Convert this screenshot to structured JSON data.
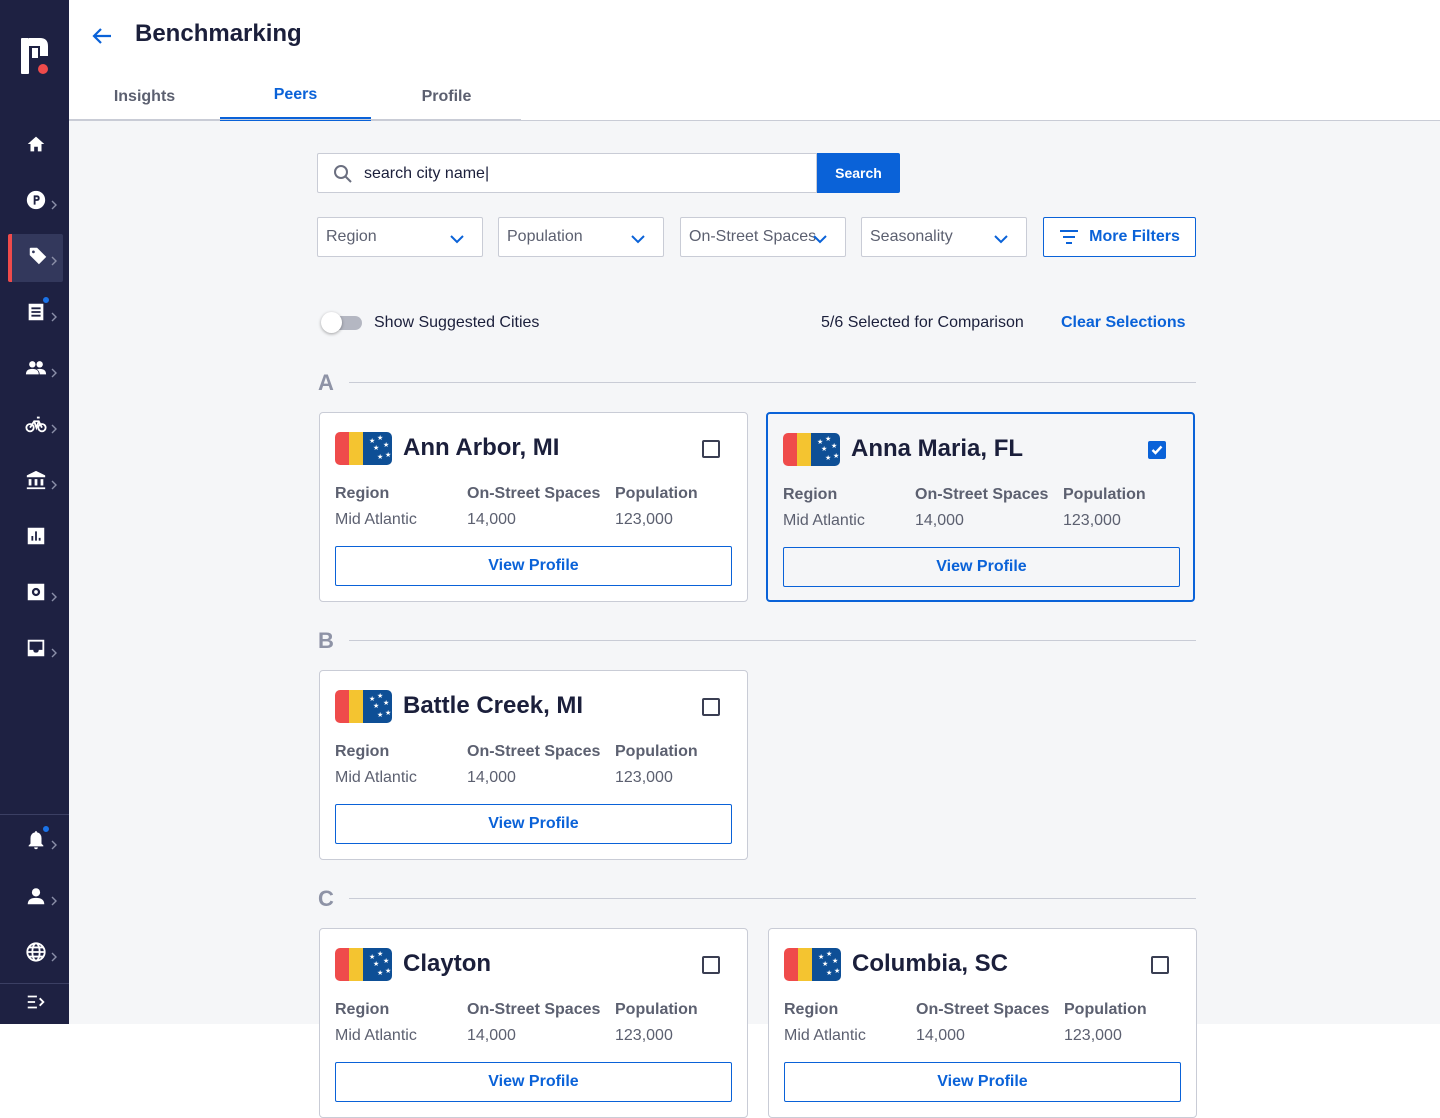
{
  "header": {
    "title": "Benchmarking",
    "tabs": [
      {
        "label": "Insights"
      },
      {
        "label": "Peers"
      },
      {
        "label": "Profile"
      }
    ]
  },
  "search": {
    "value": "search city name|",
    "button_label": "Search"
  },
  "filters": {
    "region": "Region",
    "population": "Population",
    "on_street": "On-Street Spaces",
    "seasonality": "Seasonality",
    "more": "More Filters"
  },
  "toolbar": {
    "toggle_label": "Show Suggested Cities",
    "selected_count": "5/6 Selected for Comparison",
    "clear_label": "Clear Selections"
  },
  "groups": [
    {
      "letter": "A"
    },
    {
      "letter": "B"
    },
    {
      "letter": "C"
    }
  ],
  "card_labels": {
    "region": "Region",
    "spaces": "On-Street Spaces",
    "population": "Population",
    "view": "View Profile"
  },
  "cities": [
    {
      "name": "Ann Arbor, MI",
      "region": "Mid Atlantic",
      "spaces": "14,000",
      "population": "123,000",
      "selected": false
    },
    {
      "name": "Anna Maria, FL",
      "region": "Mid Atlantic",
      "spaces": "14,000",
      "population": "123,000",
      "selected": true
    },
    {
      "name": "Battle Creek, MI",
      "region": "Mid Atlantic",
      "spaces": "14,000",
      "population": "123,000",
      "selected": false
    },
    {
      "name": "Clayton",
      "region": "Mid Atlantic",
      "spaces": "14,000",
      "population": "123,000",
      "selected": false
    },
    {
      "name": "Columbia, SC",
      "region": "Mid Atlantic",
      "spaces": "14,000",
      "population": "123,000",
      "selected": false
    }
  ],
  "colors": {
    "sidebar": "#1e2142",
    "accent": "#0a62d8",
    "active_marker": "#ef4b4b"
  },
  "sidebar_icons": [
    "home-icon",
    "parking-icon",
    "tag-icon",
    "receipt-icon",
    "people-icon",
    "bike-icon",
    "bank-icon",
    "chart-icon",
    "settings-icon",
    "inbox-icon",
    "bell-icon",
    "user-icon",
    "globe-icon",
    "collapse-icon"
  ]
}
